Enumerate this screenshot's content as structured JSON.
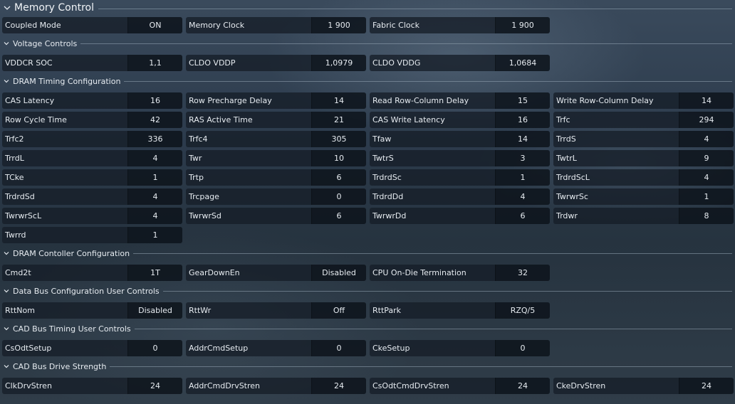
{
  "title": "Memory Control",
  "colors": {
    "label_bg": "#161e28",
    "value_bg": "#0e141c",
    "text": "#e6ebf0",
    "rule": "#96a5b4"
  },
  "sections": [
    {
      "title": "",
      "rows": [
        [
          {
            "label": "Coupled Mode",
            "value": "ON"
          },
          {
            "label": "Memory Clock",
            "value": "1 900"
          },
          {
            "label": "Fabric Clock",
            "value": "1 900"
          }
        ]
      ]
    },
    {
      "title": "Voltage Controls",
      "rows": [
        [
          {
            "label": "VDDCR SOC",
            "value": "1,1"
          },
          {
            "label": "CLDO VDDP",
            "value": "1,0979"
          },
          {
            "label": "CLDO VDDG",
            "value": "1,0684"
          }
        ]
      ]
    },
    {
      "title": "DRAM Timing Configuration",
      "rows": [
        [
          {
            "label": "CAS Latency",
            "value": "16"
          },
          {
            "label": "Row Precharge Delay",
            "value": "14"
          },
          {
            "label": "Read Row-Column Delay",
            "value": "15"
          },
          {
            "label": "Write Row-Column Delay",
            "value": "14"
          }
        ],
        [
          {
            "label": "Row Cycle Time",
            "value": "42"
          },
          {
            "label": "RAS Active Time",
            "value": "21"
          },
          {
            "label": "CAS Write Latency",
            "value": "16"
          },
          {
            "label": "Trfc",
            "value": "294"
          }
        ],
        [
          {
            "label": "Trfc2",
            "value": "336"
          },
          {
            "label": "Trfc4",
            "value": "305"
          },
          {
            "label": "Tfaw",
            "value": "14"
          },
          {
            "label": "TrrdS",
            "value": "4"
          }
        ],
        [
          {
            "label": "TrrdL",
            "value": "4"
          },
          {
            "label": "Twr",
            "value": "10"
          },
          {
            "label": "TwtrS",
            "value": "3"
          },
          {
            "label": "TwtrL",
            "value": "9"
          }
        ],
        [
          {
            "label": "TCke",
            "value": "1"
          },
          {
            "label": "Trtp",
            "value": "6"
          },
          {
            "label": "TrdrdSc",
            "value": "1"
          },
          {
            "label": "TrdrdScL",
            "value": "4"
          }
        ],
        [
          {
            "label": "TrdrdSd",
            "value": "4"
          },
          {
            "label": "Trcpage",
            "value": "0"
          },
          {
            "label": "TrdrdDd",
            "value": "4"
          },
          {
            "label": "TwrwrSc",
            "value": "1"
          }
        ],
        [
          {
            "label": "TwrwrScL",
            "value": "4"
          },
          {
            "label": "TwrwrSd",
            "value": "6"
          },
          {
            "label": "TwrwrDd",
            "value": "6"
          },
          {
            "label": "Trdwr",
            "value": "8"
          }
        ],
        [
          {
            "label": "Twrrd",
            "value": "1"
          }
        ]
      ]
    },
    {
      "title": "DRAM Contoller Configuration",
      "rows": [
        [
          {
            "label": "Cmd2t",
            "value": "1T"
          },
          {
            "label": "GearDownEn",
            "value": "Disabled"
          },
          {
            "label": "CPU On-Die Termination",
            "value": "32"
          }
        ]
      ]
    },
    {
      "title": "Data Bus Configuration User Controls",
      "rows": [
        [
          {
            "label": "RttNom",
            "value": "Disabled"
          },
          {
            "label": "RttWr",
            "value": "Off"
          },
          {
            "label": "RttPark",
            "value": "RZQ/5"
          }
        ]
      ]
    },
    {
      "title": "CAD Bus Timing User Controls",
      "rows": [
        [
          {
            "label": "CsOdtSetup",
            "value": "0"
          },
          {
            "label": "AddrCmdSetup",
            "value": "0"
          },
          {
            "label": "CkeSetup",
            "value": "0"
          }
        ]
      ]
    },
    {
      "title": "CAD Bus Drive Strength",
      "rows": [
        [
          {
            "label": "ClkDrvStren",
            "value": "24"
          },
          {
            "label": "AddrCmdDrvStren",
            "value": "24"
          },
          {
            "label": "CsOdtCmdDrvStren",
            "value": "24"
          },
          {
            "label": "CkeDrvStren",
            "value": "24"
          }
        ]
      ]
    }
  ]
}
